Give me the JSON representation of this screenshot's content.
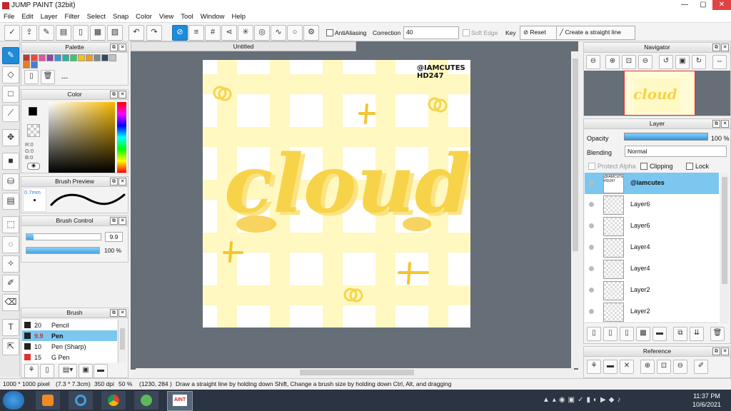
{
  "window": {
    "title": "JUMP PAINT (32bit)",
    "minimize": "—",
    "maximize": "▢",
    "close": "✕"
  },
  "menu": [
    "File",
    "Edit",
    "Layer",
    "Filter",
    "Select",
    "Snap",
    "Color",
    "View",
    "Tool",
    "Window",
    "Help"
  ],
  "toolbar": {
    "antialiasing_label": "AntiAliasing",
    "correction_label": "Correction",
    "correction_value": "40",
    "soft_edge_label": "Soft Edge",
    "key_label": "Key",
    "reset_label": "Reset",
    "straight_line_label": "Create a straight line"
  },
  "palette": {
    "title": "Palette",
    "set_name": "---",
    "swatches": [
      "#c0392b",
      "#e74c3c",
      "#e056a4",
      "#8e44ad",
      "#3498db",
      "#1abc9c",
      "#2ecc71",
      "#f1c40f",
      "#f39c12",
      "#7f8c8d",
      "#34495e",
      "#bdc3c7",
      "#e67e22",
      "#3d7fd9"
    ]
  },
  "color": {
    "title": "Color",
    "r": "R:0",
    "g": "G:0",
    "b": "B:0",
    "primary": "#000000",
    "secondary": "#ffffff"
  },
  "brush_preview": {
    "title": "Brush Preview",
    "size_text": "0.7mm"
  },
  "brush_control": {
    "title": "Brush Control",
    "size_value": "9.9",
    "opacity_value": "100 %",
    "size_fraction": 0.1,
    "opacity_fraction": 1.0
  },
  "brush": {
    "title": "Brush",
    "items": [
      {
        "size": "20",
        "name": "Pencil"
      },
      {
        "size": "9.9",
        "name": "Pen"
      },
      {
        "size": "10",
        "name": "Pen (Sharp)"
      },
      {
        "size": "15",
        "name": "G Pen"
      }
    ]
  },
  "document": {
    "tab": "Untitled"
  },
  "artwork": {
    "credit_line1": "@IAMCUTES",
    "credit_line2": "HD247",
    "word": "cloud"
  },
  "navigator": {
    "title": "Navigator",
    "thumb_word": "cloud"
  },
  "layer": {
    "title": "Layer",
    "opacity_label": "Opacity",
    "opacity_value": "100 %",
    "opacity_fraction": 1.0,
    "blending_label": "Blending",
    "blending_value": "Normal",
    "protect_alpha_label": "Protect Alpha",
    "clipping_label": "Clipping",
    "lock_label": "Lock",
    "thumb_credit": "@IAMCUTES HD247",
    "layers": [
      "@iamcutes",
      "Layer6",
      "Layer6",
      "Layer4",
      "Layer4",
      "Layer2",
      "Layer2"
    ]
  },
  "reference": {
    "title": "Reference"
  },
  "status": {
    "dimensions": "1000 * 1000 pixel",
    "size_cm": "(7.3 * 7.3cm)",
    "dpi": "350 dpi",
    "zoom": "50 %",
    "coords": "(1230, 284 )",
    "hint": "Draw a straight line by holding down Shift, Change a brush size by holding down Ctrl, Alt, and dragging"
  },
  "taskbar": {
    "time": "11:37 PM",
    "date": "10/6/2021",
    "app_label": "AINT"
  }
}
